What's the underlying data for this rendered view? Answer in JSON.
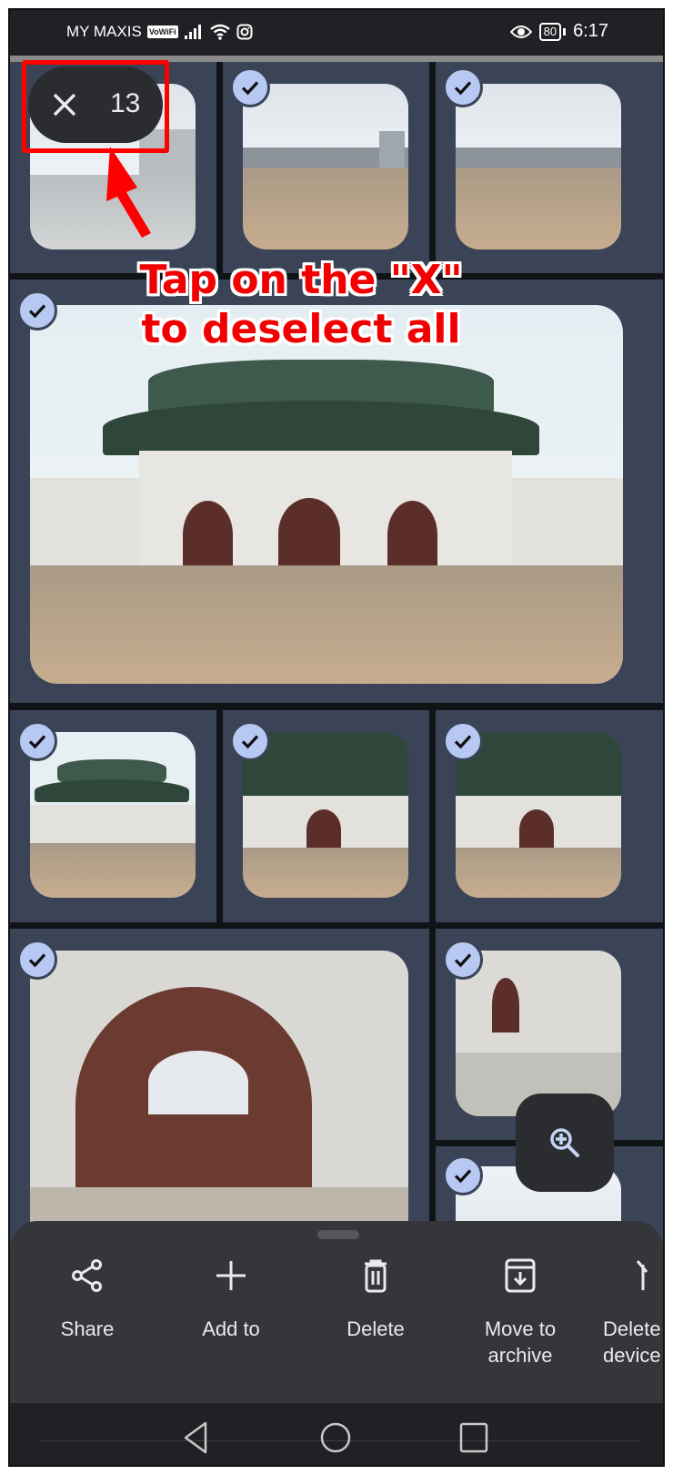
{
  "status_bar": {
    "carrier": "MY MAXIS",
    "vowifi_badge": "VoWiFi",
    "battery_level": "80",
    "time": "6:17",
    "icons": [
      "signal-icon",
      "wifi-icon",
      "instagram-icon",
      "eye-icon",
      "battery-icon"
    ]
  },
  "selection": {
    "close_icon": "close-icon",
    "selected_count": "13"
  },
  "annotation": {
    "line1": "Tap on the \"X\"",
    "line2": "to deselect all"
  },
  "photos": [
    {
      "id": "photo-1",
      "selected": false,
      "subject": "statue plaza"
    },
    {
      "id": "photo-2",
      "selected": true,
      "subject": "city plaza"
    },
    {
      "id": "photo-3",
      "selected": true,
      "subject": "city plaza"
    },
    {
      "id": "photo-4",
      "selected": true,
      "subject": "palace gate"
    },
    {
      "id": "photo-5",
      "selected": true,
      "subject": "palace gate"
    },
    {
      "id": "photo-6",
      "selected": true,
      "subject": "palace gate"
    },
    {
      "id": "photo-7",
      "selected": true,
      "subject": "palace gate"
    },
    {
      "id": "photo-8",
      "selected": true,
      "subject": "gate arch with guards"
    },
    {
      "id": "photo-9",
      "selected": true,
      "subject": "guards"
    },
    {
      "id": "photo-10",
      "selected": true,
      "subject": "sky"
    }
  ],
  "fab": {
    "icon": "zoom-in-icon"
  },
  "bottom_sheet": {
    "actions": [
      {
        "label": "Share",
        "icon": "share-icon"
      },
      {
        "label": "Add to",
        "icon": "plus-icon"
      },
      {
        "label": "Delete",
        "icon": "trash-icon"
      },
      {
        "label": "Move to archive",
        "icon": "archive-icon"
      },
      {
        "label": "Delete from device",
        "icon": "delete-device-icon"
      }
    ]
  },
  "nav_bar": {
    "buttons": [
      "back-icon",
      "home-icon",
      "recents-icon"
    ]
  },
  "colors": {
    "accent_red": "#ff0000",
    "check_badge": "#b7c9f2",
    "cell_bg": "#3a4456",
    "sheet_bg": "#35363a"
  }
}
